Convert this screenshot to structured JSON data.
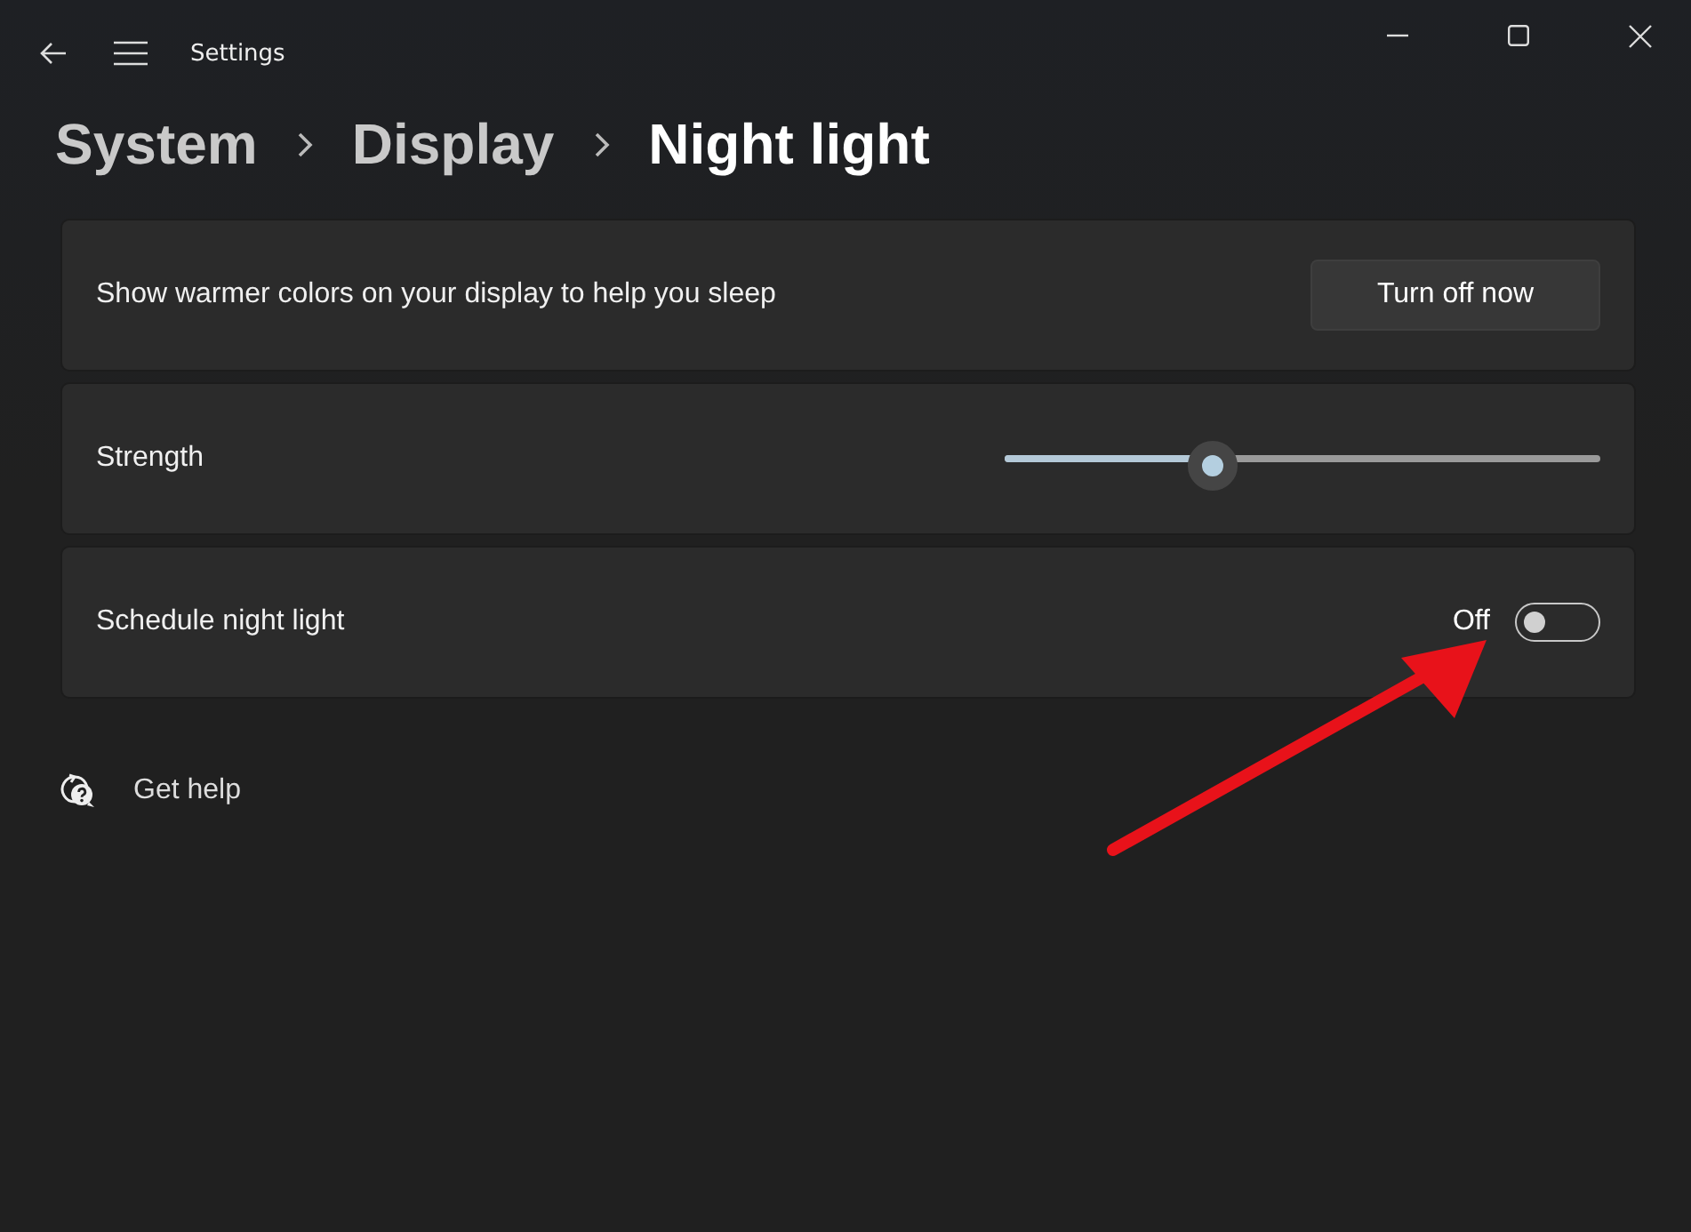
{
  "window": {
    "title": "Settings"
  },
  "breadcrumb": [
    {
      "label": "System",
      "current": false
    },
    {
      "label": "Display",
      "current": false
    },
    {
      "label": "Night light",
      "current": true
    }
  ],
  "cards": [
    {
      "kind": "button",
      "label": "Show warmer colors on your display to help you sleep",
      "button": "Turn off now"
    },
    {
      "kind": "slider",
      "label": "Strength",
      "level": 0.35
    },
    {
      "kind": "toggle",
      "label": "Schedule night light",
      "state_text": "Off",
      "on": false
    }
  ],
  "help": {
    "label": "Get help"
  }
}
